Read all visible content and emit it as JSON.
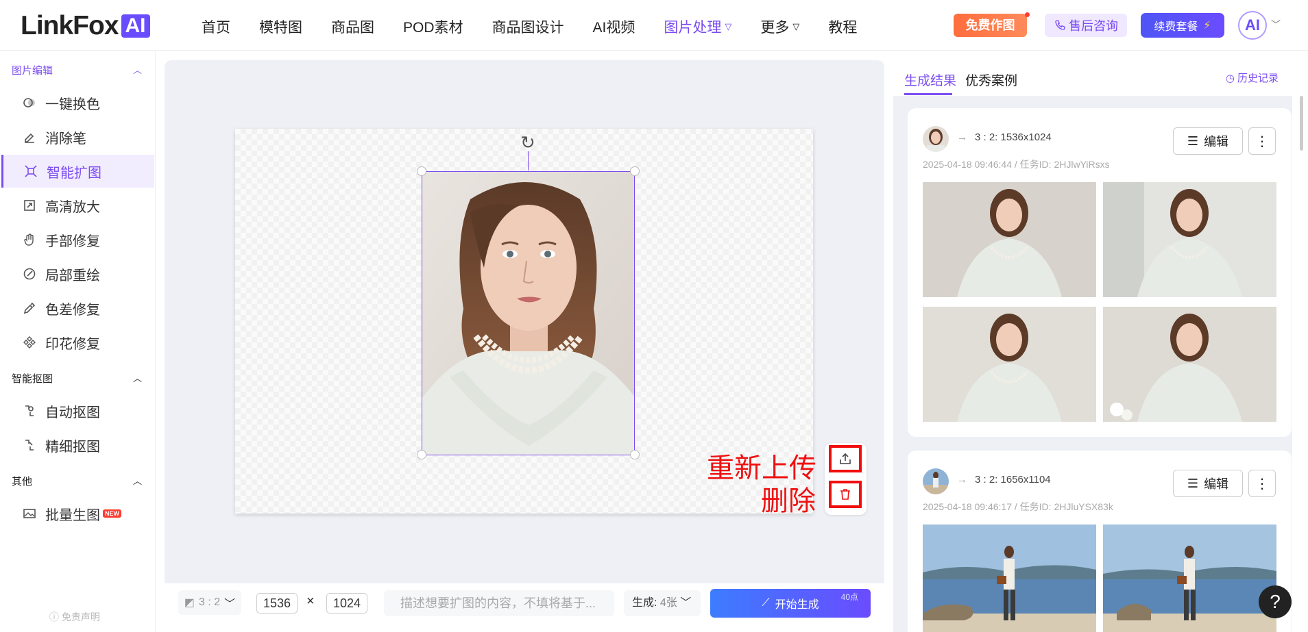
{
  "brand": {
    "name": "LinkFox",
    "badge": "AI"
  },
  "nav": {
    "items": [
      "首页",
      "模特图",
      "商品图",
      "POD素材",
      "商品图设计",
      "AI视频",
      "图片处理",
      "更多",
      "教程"
    ],
    "active": "图片处理"
  },
  "header": {
    "free_btn": "免费作图",
    "support_btn": "售后咨询",
    "renew_btn": "续费套餐",
    "avatar": "AI"
  },
  "sidebar": {
    "sections": [
      {
        "title": "图片编辑",
        "items": [
          {
            "label": "一键换色",
            "icon": "color-swap-icon"
          },
          {
            "label": "消除笔",
            "icon": "eraser-icon"
          },
          {
            "label": "智能扩图",
            "icon": "expand-icon",
            "active": true
          },
          {
            "label": "高清放大",
            "icon": "upscale-icon"
          },
          {
            "label": "手部修复",
            "icon": "hand-icon"
          },
          {
            "label": "局部重绘",
            "icon": "brush-icon"
          },
          {
            "label": "色差修复",
            "icon": "dropper-icon"
          },
          {
            "label": "印花修复",
            "icon": "pattern-icon"
          }
        ]
      },
      {
        "title": "智能抠图",
        "items": [
          {
            "label": "自动抠图",
            "icon": "auto-cutout-icon"
          },
          {
            "label": "精细抠图",
            "icon": "fine-cutout-icon"
          }
        ]
      },
      {
        "title": "其他",
        "items": [
          {
            "label": "批量生图",
            "icon": "image-batch-icon",
            "badge": "NEW"
          }
        ]
      }
    ],
    "disclaimer": "免责声明"
  },
  "canvas": {
    "annotations": {
      "reupload": "重新上传",
      "delete": "删除"
    }
  },
  "bottombar": {
    "ratio": "3 : 2",
    "width": "1536",
    "times": "×",
    "height": "1024",
    "prompt_placeholder": "描述想要扩图的内容，不填将基于...",
    "gen_label": "生成:",
    "gen_count": "4张",
    "gen_button": "开始生成",
    "points": "40点"
  },
  "results": {
    "tabs": [
      "生成结果",
      "优秀案例"
    ],
    "history": "历史记录",
    "cards": [
      {
        "spec": "3 : 2:  1536x1024",
        "meta": "2025-04-18 09:46:44 / 任务ID: 2HJlwYiRsxs",
        "edit": "编辑"
      },
      {
        "spec": "3 : 2:  1656x1104",
        "meta": "2025-04-18 09:46:17 / 任务ID: 2HJluYSX83k",
        "edit": "编辑"
      }
    ]
  },
  "help": "?",
  "colors": {
    "accent": "#7b4cf0",
    "annotation": "#ee1111",
    "free_btn": "#ff6d3d"
  }
}
